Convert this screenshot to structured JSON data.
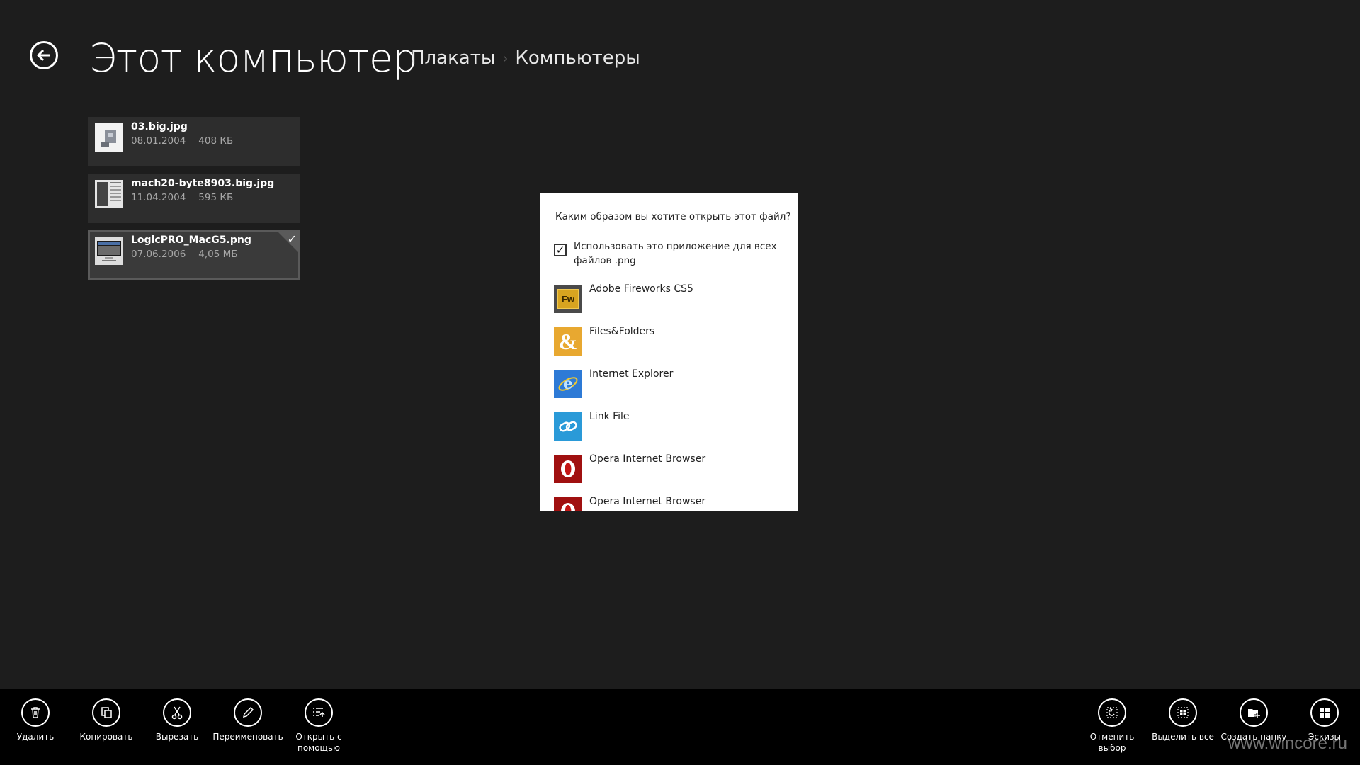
{
  "header": {
    "title": "Этот компьютер",
    "breadcrumb": [
      "Плакаты",
      "Компьютеры"
    ]
  },
  "files": [
    {
      "name": "03.big.jpg",
      "date": "08.01.2004",
      "size": "408 КБ",
      "selected": false
    },
    {
      "name": "mach20-byte8903.big.jpg",
      "date": "11.04.2004",
      "size": "595 КБ",
      "selected": false
    },
    {
      "name": "LogicPRO_MacG5.png",
      "date": "07.06.2006",
      "size": "4,05 МБ",
      "selected": true
    }
  ],
  "dialog": {
    "question": "Каким образом вы хотите открыть этот файл?",
    "checkbox_label": "Использовать это приложение для всех файлов .png",
    "checkbox_checked": true,
    "apps": [
      {
        "name": "Adobe Fireworks CS5",
        "icon": "fireworks-icon"
      },
      {
        "name": "Files&Folders",
        "icon": "ampersand-icon"
      },
      {
        "name": "Internet Explorer",
        "icon": "internet-explorer-icon"
      },
      {
        "name": "Link File",
        "icon": "link-icon"
      },
      {
        "name": "Opera Internet Browser",
        "icon": "opera-icon"
      },
      {
        "name": "Opera Internet Browser",
        "icon": "opera-icon"
      }
    ]
  },
  "appbar": {
    "left": [
      {
        "label": "Удалить",
        "icon": "trash-icon"
      },
      {
        "label": "Копировать",
        "icon": "copy-icon"
      },
      {
        "label": "Вырезать",
        "icon": "scissors-icon"
      },
      {
        "label": "Переименовать",
        "icon": "pencil-icon"
      },
      {
        "label": "Открыть с помощью",
        "icon": "open-with-icon"
      }
    ],
    "right": [
      {
        "label": "Отменить выбор",
        "icon": "clear-selection-icon"
      },
      {
        "label": "Выделить все",
        "icon": "select-all-icon"
      },
      {
        "label": "Создать папку",
        "icon": "new-folder-icon"
      },
      {
        "label": "Эскизы",
        "icon": "thumbnails-icon"
      }
    ]
  },
  "watermark": "www.wincore.ru",
  "colors": {
    "background": "#1d1d1d",
    "appbar": "#000000",
    "tile": "#2d2d2d",
    "dialog": "#ffffff"
  }
}
